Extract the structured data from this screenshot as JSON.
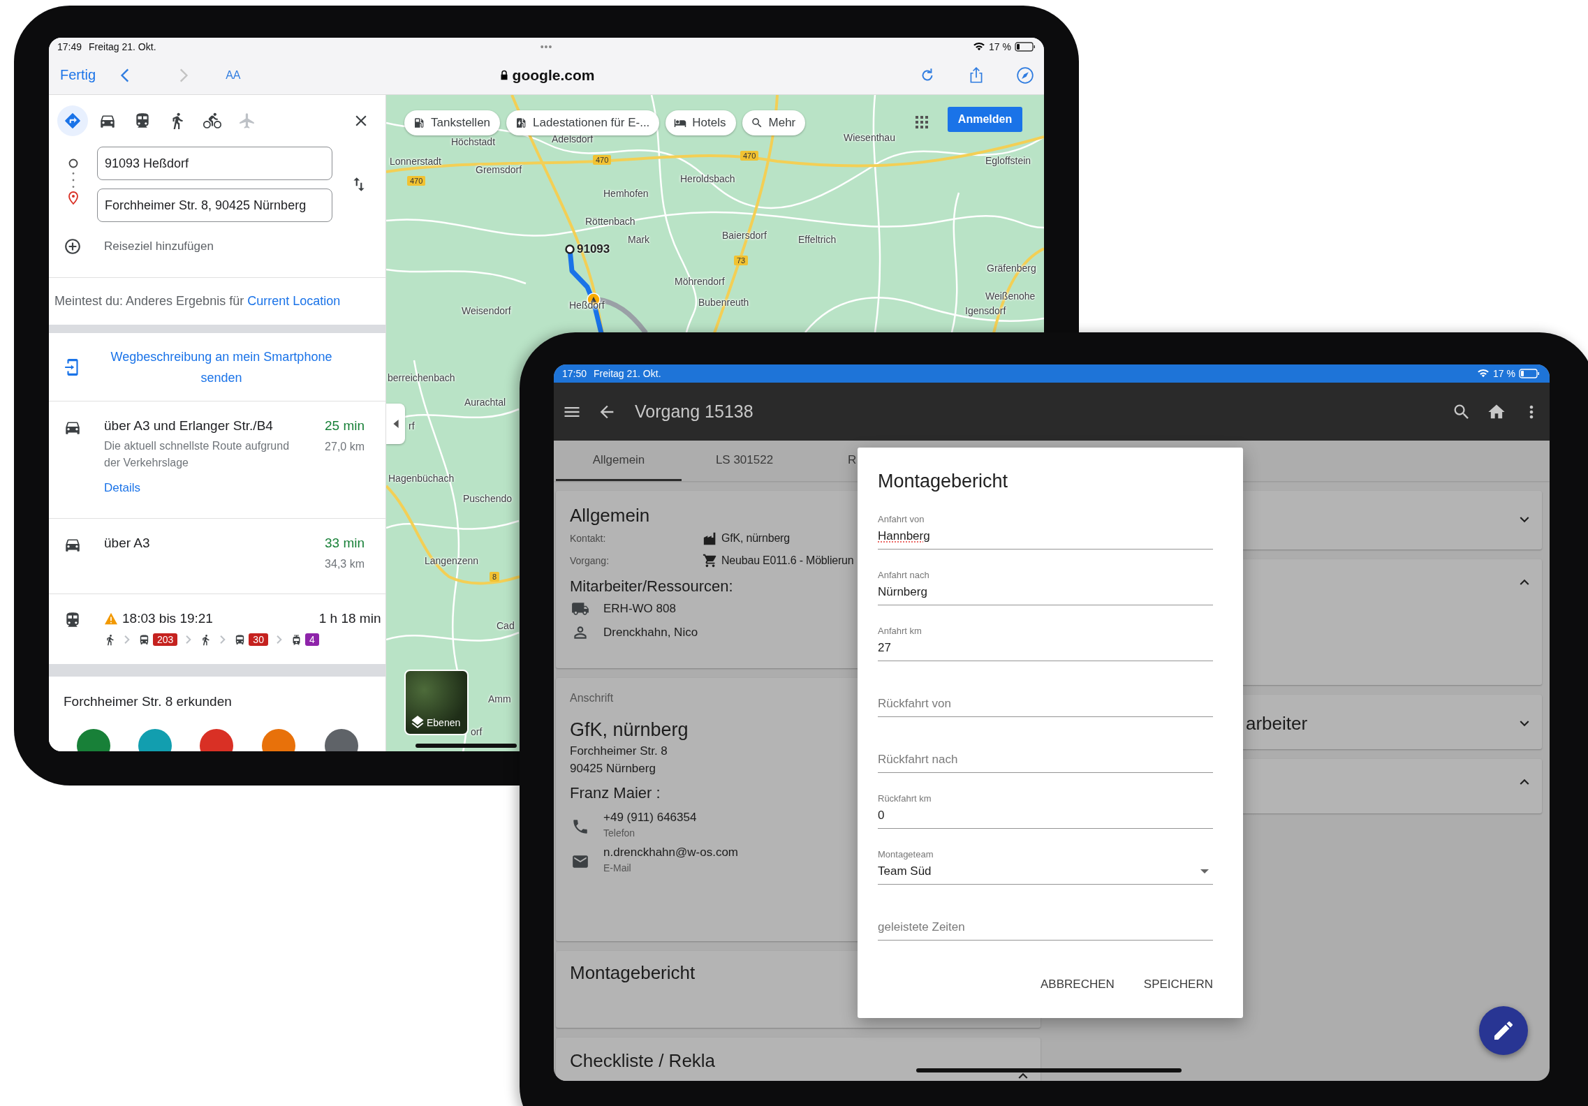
{
  "left_tablet": {
    "status_bar": {
      "time": "17:49",
      "date": "Freitag 21. Okt.",
      "dots": "•••",
      "battery": "17 %"
    },
    "browser_toolbar": {
      "done": "Fertig",
      "text_size": "AA",
      "address": "google.com"
    },
    "directions_panel": {
      "modes": [
        {
          "kind": "directions",
          "selected": true,
          "disabled": false
        },
        {
          "kind": "car",
          "selected": false,
          "disabled": false
        },
        {
          "kind": "transit",
          "selected": false,
          "disabled": false
        },
        {
          "kind": "walk",
          "selected": false,
          "disabled": false
        },
        {
          "kind": "bike",
          "selected": false,
          "disabled": false
        },
        {
          "kind": "flight",
          "selected": false,
          "disabled": true
        }
      ],
      "origin": "91093 Heßdorf",
      "destination": "Forchheimer Str. 8, 90425 Nürnberg",
      "add_destination": "Reiseziel hinzufügen",
      "suggestion": {
        "text": "Meintest du: Anderes Ergebnis für",
        "link": "Current Location"
      },
      "send_to_phone": "Wegbeschreibung an mein Smartphone senden",
      "routes": [
        {
          "kind": "car",
          "title": "über A3 und Erlanger Str./B4",
          "warning": false,
          "duration": "25 min",
          "distance": "27,0 km",
          "description": "Die aktuell schnellste Route aufgrund der Verkehrslage",
          "link": "Details"
        },
        {
          "kind": "car",
          "title": "über A3",
          "warning": false,
          "duration": "33 min",
          "distance": "34,3 km"
        },
        {
          "kind": "transit",
          "title": "18:03 bis 19:21",
          "warning": true,
          "duration": "1 h 18 min",
          "legs": [
            {
              "kind": "walk"
            },
            {
              "kind": "bus",
              "line": "203",
              "color": "#c5221f"
            },
            {
              "kind": "walk"
            },
            {
              "kind": "bus",
              "line": "30",
              "color": "#c5221f"
            },
            {
              "kind": "tram",
              "line": "4",
              "color": "#8e24aa"
            }
          ]
        }
      ],
      "explore_title": "Forchheimer Str. 8 erkunden",
      "explore_buttons": [
        {
          "color": "#188038"
        },
        {
          "color": "#129eaf"
        },
        {
          "color": "#d93025"
        },
        {
          "color": "#e8710a"
        },
        {
          "color": "#5f6368"
        }
      ]
    },
    "map": {
      "chips": [
        {
          "kind": "fuel",
          "label": "Tankstellen"
        },
        {
          "kind": "charging",
          "label": "Ladestationen für E-..."
        },
        {
          "kind": "hotel",
          "label": "Hotels"
        },
        {
          "kind": "search",
          "label": "Mehr"
        }
      ],
      "sign_in": "Anmelden",
      "pin_label": "91093",
      "layers": "Ebenen",
      "places": [
        "Höchstadt",
        "Adelsdorf",
        "Wiesenthau",
        "Lonnerstadt",
        "Gremsdorf",
        "Egloffstein",
        "Heroldsbach",
        "Hemhofen",
        "Röttenbach",
        "Mark",
        "Baiersdorf",
        "Effeltrich",
        "Gräfenberg",
        "Möhrendorf",
        "Weißenohe",
        "Bubenreuth",
        "Heßdorf",
        "Weisendorf",
        "Igensdorf",
        "berreichenbach",
        "Aurachtal",
        "rf",
        "Hagenbüchach",
        "Puschendo",
        "Langenzenn",
        "Cad",
        "Amm",
        "orf"
      ],
      "road_numbers": [
        "470",
        "470",
        "470",
        "73",
        "8"
      ]
    }
  },
  "right_tablet": {
    "status_bar": {
      "time": "17:50",
      "date": "Freitag 21. Okt.",
      "battery": "17 %"
    },
    "app_bar": {
      "title": "Vorgang 15138"
    },
    "tabs": [
      {
        "label": "Allgemein",
        "selected": true
      },
      {
        "label": "LS 301522",
        "selected": false
      },
      {
        "label": "R",
        "selected": false
      }
    ],
    "general_card": {
      "title": "Allgemein",
      "fields": [
        {
          "label": "Kontakt:",
          "kind": "customer",
          "value": "GfK, nürnberg"
        },
        {
          "label": "Vorgang:",
          "kind": "order",
          "value": "Neubau E011.6 - Möblierun"
        }
      ],
      "resources_title": "Mitarbeiter/Ressourcen:",
      "resources": [
        {
          "kind": "vehicle",
          "name": "ERH-WO 808"
        },
        {
          "kind": "person",
          "name": "Drenckhahn, Nico"
        }
      ]
    },
    "address_card": {
      "caption": "Anschrift",
      "company": "GfK, nürnberg",
      "street": "Forchheimer Str. 8",
      "city": "90425 Nürnberg",
      "contact_name": "Franz Maier :",
      "contacts": [
        {
          "kind": "phone",
          "value": "+49 (911) 646354",
          "type": "Telefon"
        },
        {
          "kind": "email",
          "value": "n.drenckhahn@w-os.com",
          "type": "E-Mail"
        }
      ]
    },
    "report_card": {
      "title": "Montagebericht"
    },
    "checklist_card": {
      "title": "Checkliste / Rekla",
      "expanded": true
    },
    "right_sections": [
      {
        "expanded": false
      },
      {
        "expanded": true
      },
      {
        "title": "arbeiter",
        "expanded": false
      },
      {
        "expanded": true
      }
    ],
    "dialog": {
      "title": "Montagebericht",
      "fields": [
        {
          "kind": "text",
          "label": "Anfahrt von",
          "value": "Hannberg",
          "misspelled": true
        },
        {
          "kind": "text",
          "label": "Anfahrt nach",
          "value": "Nürnberg",
          "misspelled": false
        },
        {
          "kind": "text",
          "label": "Anfahrt km",
          "value": "27",
          "misspelled": false
        },
        {
          "kind": "text",
          "placeholder": "Rückfahrt von",
          "misspelled": false
        },
        {
          "kind": "text",
          "placeholder": "Rückfahrt nach",
          "misspelled": false
        },
        {
          "kind": "text",
          "label": "Rückfahrt km",
          "value": "0",
          "misspelled": false
        },
        {
          "kind": "select",
          "label": "Montageteam",
          "value": "Team Süd",
          "misspelled": false
        },
        {
          "kind": "text",
          "placeholder": "geleistete Zeiten",
          "misspelled": false
        }
      ],
      "buttons": [
        "ABBRECHEN",
        "SPEICHERN"
      ]
    }
  }
}
